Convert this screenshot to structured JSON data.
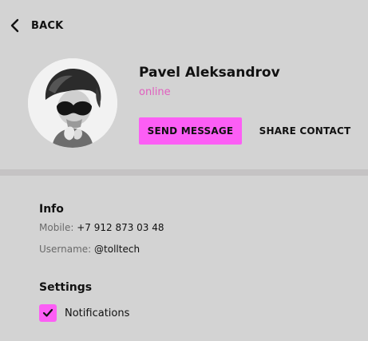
{
  "header": {
    "back_label": "BACK"
  },
  "profile": {
    "name": "Pavel Aleksandrov",
    "status": "online",
    "avatar_icon": "user-photo",
    "send_message_label": "SEND MESSAGE",
    "share_contact_label": "SHARE CONTACT"
  },
  "info": {
    "title": "Info",
    "mobile_label": "Mobile:",
    "mobile_value": "+7 912 873 03 48",
    "username_label": "Username:",
    "username_value": "@tolltech"
  },
  "settings": {
    "title": "Settings",
    "notifications_label": "Notifications",
    "notifications_checked": true
  },
  "colors": {
    "accent": "#fc5ef5",
    "status_online": "#e05fbf",
    "background": "#d3d3d3",
    "divider": "#c5c3c4"
  }
}
